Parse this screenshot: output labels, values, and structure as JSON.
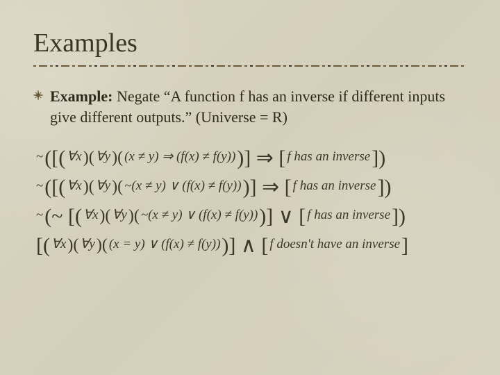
{
  "title": "Examples",
  "prompt": {
    "label": "Example:",
    "text": "  Negate “A function f has an inverse if different inputs give different outputs.” (Universe = R)"
  },
  "math": {
    "line1": {
      "neg": "~",
      "open": "([(",
      "q1": "∀x",
      "mid1": ")(",
      "q2": "∀y",
      "mid2": ")(",
      "inner": "(x ≠ y)  ⇒  (f(x) ≠ f(y))",
      "close1": ")] ⇒ [",
      "tail": "f has an inverse",
      "close2": "])"
    },
    "line2": {
      "neg": "~",
      "open": "([(",
      "q1": "∀x",
      "mid1": ")(",
      "q2": "∀y",
      "mid2": ")(",
      "inner": "~(x ≠ y)  ∨  (f(x) ≠ f(y))",
      "close1": ")] ⇒ [",
      "tail": "f has an inverse",
      "close2": "])"
    },
    "line3": {
      "neg": "~",
      "open": "(~ [(",
      "q1": "∀x",
      "mid1": ")(",
      "q2": "∀y",
      "mid2": ")(",
      "inner": "~(x ≠ y)  ∨  (f(x) ≠ f(y))",
      "close1": ")] ∨ [",
      "tail": "f has an inverse",
      "close2": "])"
    },
    "line4": {
      "open": "[(",
      "q1": "∀x",
      "mid1": ")(",
      "q2": "∀y",
      "mid2": ")(",
      "inner": "(x = y)  ∨  (f(x) ≠ f(y))",
      "close1": ")] ∧ [",
      "tail": "f doesn't have an inverse",
      "close2": "]"
    }
  }
}
